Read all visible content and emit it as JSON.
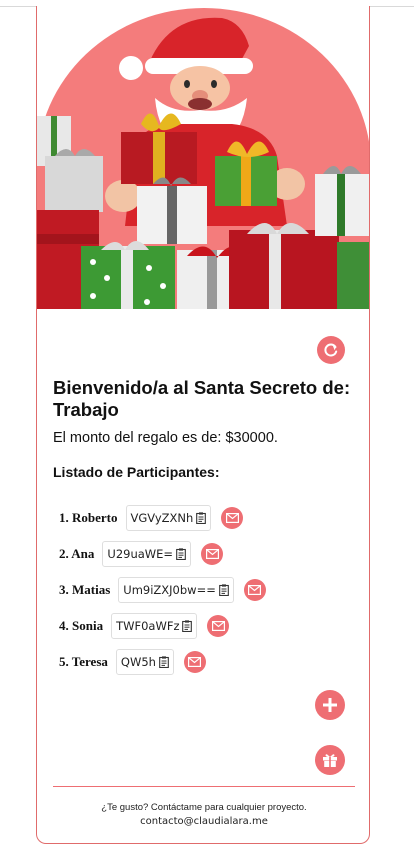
{
  "header": {
    "title": "Bienvenido/a al Santa Secreto de: Trabajo",
    "amount_text": "El monto del regalo es de: $30000."
  },
  "participants": {
    "heading": "Listado de Participantes:",
    "items": [
      {
        "name": "1. Roberto",
        "code": "VGVyZXNh"
      },
      {
        "name": "2. Ana",
        "code": "U29uaWE="
      },
      {
        "name": "3. Matias",
        "code": "Um9iZXJ0bw=="
      },
      {
        "name": "4. Sonia",
        "code": "TWF0aWFz"
      },
      {
        "name": "5. Teresa",
        "code": "QW5h"
      }
    ]
  },
  "icons": {
    "reset": "refresh-icon",
    "add": "plus-icon",
    "gift": "gift-icon",
    "mail": "envelope-icon",
    "copy": "clipboard-icon"
  },
  "colors": {
    "accent": "#ee6e73",
    "hero_background": "#f47c7c",
    "card_border": "#e06b6b"
  },
  "footer": {
    "line1": "¿Te gusto? Contáctame para cualquier proyecto.",
    "line2": "contacto@claudialara.me"
  }
}
